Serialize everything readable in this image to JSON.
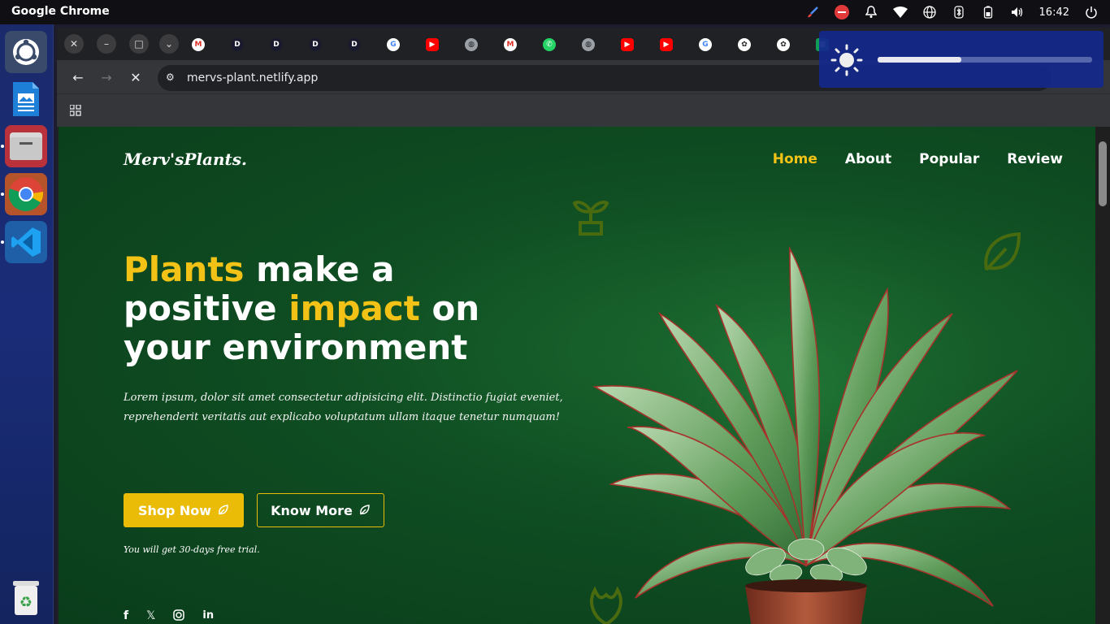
{
  "topbar": {
    "app_title": "Google Chrome",
    "time": "16:42"
  },
  "browser": {
    "url": "mervs-plant.netlify.app"
  },
  "site": {
    "logo": "Merv'sPlants.",
    "nav": [
      "Home",
      "About",
      "Popular",
      "Review"
    ],
    "headline": {
      "w1": "Plants",
      "w2": " make a",
      "w3": "positive ",
      "w4": "impact",
      "w5": " on",
      "w6": "your environment"
    },
    "subtext": "Lorem ipsum, dolor sit amet consectetur adipisicing elit. Distinctio fugiat eveniet, reprehenderit veritatis aut explicabo voluptatum ullam itaque tenetur numquam!",
    "shop_button": "Shop Now",
    "know_button": "Know More",
    "trial": "You will get 30-days free trial.",
    "social_icons": [
      "facebook-icon",
      "x-icon",
      "instagram-icon",
      "linkedin-icon"
    ]
  },
  "brightness": {
    "level": 0.39
  },
  "colors": {
    "accent": "#eabc07",
    "page_bg": "#0f4d22",
    "dock_bg": "#1a2c78"
  }
}
